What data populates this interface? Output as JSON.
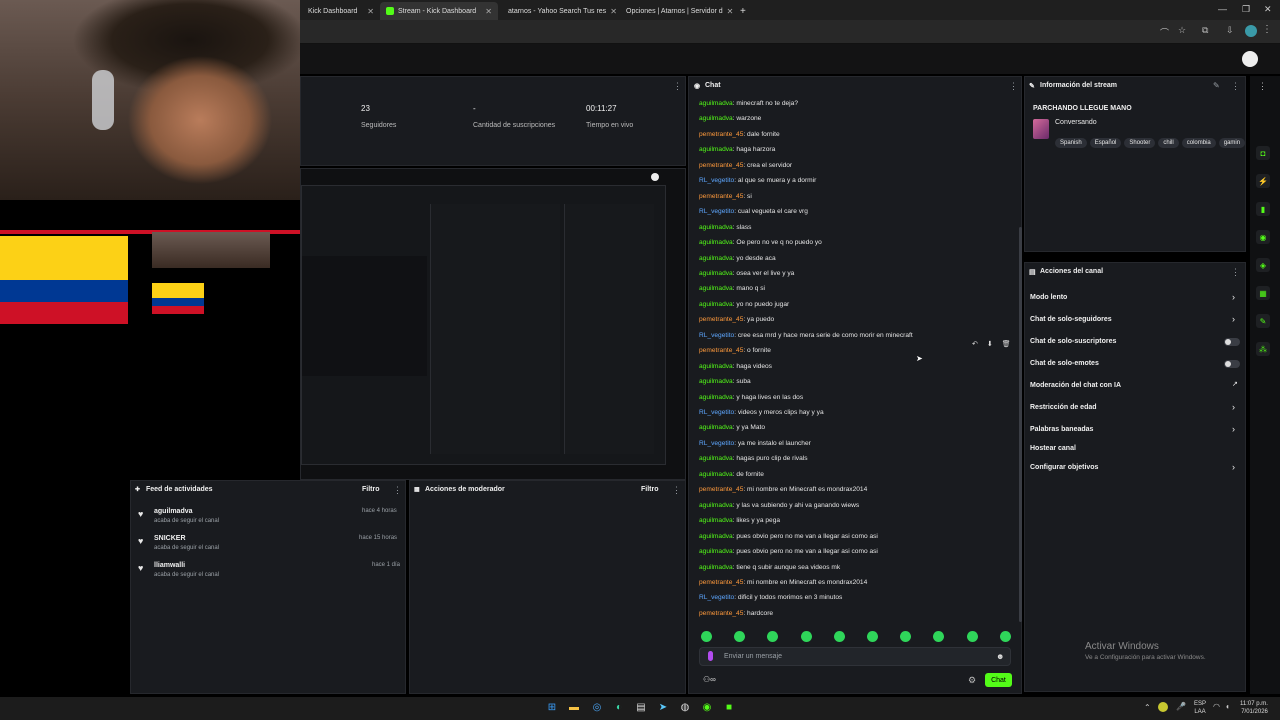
{
  "tabs": [
    {
      "label": "Kick Dashboard",
      "color": "#53fc18"
    },
    {
      "label": "Stream - Kick Dashboard",
      "color": "#53fc18"
    },
    {
      "label": "atarnos - Yahoo Search Tus res",
      "color": "#6001d2"
    },
    {
      "label": "Opciones | Atarnos | Servidor d",
      "color": "#3a7bd5"
    }
  ],
  "stats": [
    {
      "value": "23",
      "label": "Seguidores"
    },
    {
      "value": "-",
      "label": "Cantidad de suscripciones"
    },
    {
      "value": "00:11:27",
      "label": "Tiempo en vivo"
    }
  ],
  "chat": {
    "title": "Chat",
    "placeholder": "Enviar un mensaje",
    "send_label": "Chat",
    "messages": [
      {
        "user": "aguilmadva",
        "text": "minecraft no te deja?",
        "color": "green"
      },
      {
        "user": "aguilmadva",
        "text": "warzone",
        "color": "green"
      },
      {
        "user": "pemetrante_45",
        "text": "dale fornite",
        "color": "orange"
      },
      {
        "user": "aguilmadva",
        "text": "haga harzora",
        "color": "green"
      },
      {
        "user": "pemetrante_45",
        "text": "crea el servidor",
        "color": "orange"
      },
      {
        "user": "RL_vegetito",
        "text": "al que se muera y a dormir",
        "color": "blue"
      },
      {
        "user": "pemetrante_45",
        "text": "si",
        "color": "orange"
      },
      {
        "user": "RL_vegetito",
        "text": "cual vegueta el care vrg",
        "color": "blue"
      },
      {
        "user": "aguilmadva",
        "text": "slass",
        "color": "green"
      },
      {
        "user": "aguilmadva",
        "text": "Oe pero no ve q no puedo yo",
        "color": "green"
      },
      {
        "user": "aguilmadva",
        "text": "yo desde aca",
        "color": "green"
      },
      {
        "user": "aguilmadva",
        "text": "osea ver el live y ya",
        "color": "green"
      },
      {
        "user": "aguilmadva",
        "text": "mano q si",
        "color": "green"
      },
      {
        "user": "aguilmadva",
        "text": "yo no puedo jugar",
        "color": "green"
      },
      {
        "user": "pemetrante_45",
        "text": "ya puedo",
        "color": "orange"
      },
      {
        "user": "RL_vegetito",
        "text": "cree esa mrd y hace mera serie de como morir en minecraft",
        "color": "blue"
      },
      {
        "user": "pemetrante_45",
        "text": "o fornite",
        "color": "orange"
      },
      {
        "user": "aguilmadva",
        "text": "haga videos",
        "color": "green"
      },
      {
        "user": "aguilmadva",
        "text": "suba",
        "color": "green"
      },
      {
        "user": "aguilmadva",
        "text": "y haga lives en las dos",
        "color": "green"
      },
      {
        "user": "RL_vegetito",
        "text": "videos y meros clips hay y ya",
        "color": "blue"
      },
      {
        "user": "aguilmadva",
        "text": "y ya Mato",
        "color": "green"
      },
      {
        "user": "RL_vegetito",
        "text": "ya me instalo el launcher",
        "color": "blue"
      },
      {
        "user": "aguilmadva",
        "text": "hagas puro clip de rivals",
        "color": "green"
      },
      {
        "user": "aguilmadva",
        "text": "de fornite",
        "color": "green"
      },
      {
        "user": "pemetrante_45",
        "text": "mi nombre en Minecraft es mondrax2014",
        "color": "orange"
      },
      {
        "user": "aguilmadva",
        "text": "y las va subiendo y ahi va ganando wiews",
        "color": "green"
      },
      {
        "user": "aguilmadva",
        "text": "likes y ya pega",
        "color": "green"
      },
      {
        "user": "aguilmadva",
        "text": "pues obvio pero no me van a llegar asi como asi",
        "color": "green"
      },
      {
        "user": "aguilmadva",
        "text": "pues obvio pero no me van a llegar asi como asi",
        "color": "green"
      },
      {
        "user": "aguilmadva",
        "text": "tiene q subir aunque sea videos mk",
        "color": "green"
      },
      {
        "user": "pemetrante_45",
        "text": "mi nombre en Minecraft es mondrax2014",
        "color": "orange"
      },
      {
        "user": "RL_vegetito",
        "text": "dificil y todos morimos en 3 minutos",
        "color": "blue"
      },
      {
        "user": "pemetrante_45",
        "text": "hardcore",
        "color": "orange"
      }
    ]
  },
  "stream_info": {
    "title": "Información del stream",
    "stream_title": "PARCHANDO LLEGUE MANO",
    "category": "Conversando",
    "tags": [
      "Spanish",
      "Español",
      "Shooter",
      "chill",
      "colombia",
      "gamin"
    ]
  },
  "channel_actions": {
    "title": "Acciones del canal",
    "items": [
      {
        "label": "Modo lento",
        "control": "chevron"
      },
      {
        "label": "Chat de solo-seguidores",
        "control": "chevron"
      },
      {
        "label": "Chat de solo-suscriptores",
        "control": "toggle"
      },
      {
        "label": "Chat de solo-emotes",
        "control": "toggle"
      },
      {
        "label": "Moderación del chat con IA",
        "control": "external"
      },
      {
        "label": "Restricción de edad",
        "control": "chevron"
      },
      {
        "label": "Palabras baneadas",
        "control": "chevron"
      },
      {
        "label": "Hostear canal",
        "control": "none"
      },
      {
        "label": "Configurar objetivos",
        "control": "chevron"
      }
    ]
  },
  "activity_feed": {
    "title": "Feed de actividades",
    "filter": "Filtro",
    "items": [
      {
        "user": "aguilmadva",
        "action": "acaba de seguir el canal",
        "time": "hace 4 horas"
      },
      {
        "user": "SNICKER",
        "action": "acaba de seguir el canal",
        "time": "hace 15 horas"
      },
      {
        "user": "lliamwalli",
        "action": "acaba de seguir el canal",
        "time": "hace 1 día"
      }
    ]
  },
  "mod_actions": {
    "title": "Acciones de moderador",
    "filter": "Filtro"
  },
  "watermark": {
    "line1": "Activar Windows",
    "line2": "Ve a Configuración para activar Windows."
  },
  "taskbar": {
    "lang1": "ESP",
    "lang2": "LAA",
    "time": "11:07 p.m.",
    "date": "7/01/2026"
  },
  "colors": {
    "accent": "#53fc18",
    "panel": "#191b1f"
  }
}
